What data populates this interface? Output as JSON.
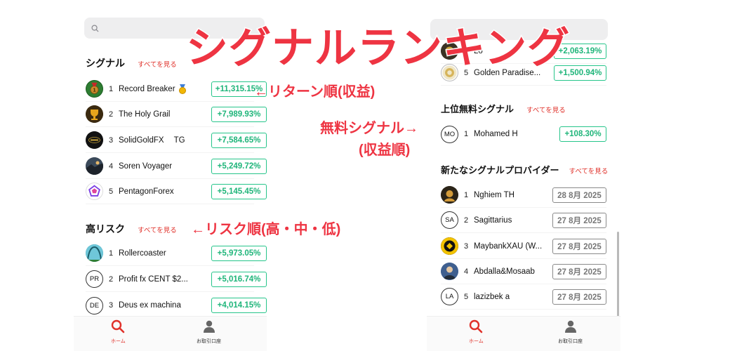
{
  "banner_title": "シグナルランキング",
  "annotations": {
    "return_order": "←リターン順(収益)",
    "risk_order": "←リスク順(高・中・低)",
    "free_signal_line1": "無料シグナル→",
    "free_signal_line2": "(収益順)"
  },
  "colors": {
    "accent": "#e0312a",
    "positive": "#1fb57a",
    "muted": "#777777",
    "annotation": "#ee3442"
  },
  "left": {
    "search": {
      "placeholder": "",
      "icon": "search-icon"
    },
    "signals": {
      "title": "シグナル",
      "see_all": "すべてを見る",
      "items": [
        {
          "rank": "1",
          "name": "Record Breaker",
          "value": "+11,315.15%",
          "medal": "🥇"
        },
        {
          "rank": "2",
          "name": "The Holy Grail",
          "value": "+7,989.93%"
        },
        {
          "rank": "3",
          "name": "SolidGoldFX",
          "suffix": "TG",
          "value": "+7,584.65%"
        },
        {
          "rank": "4",
          "name": "Soren Voyager",
          "value": "+5,249.72%"
        },
        {
          "rank": "5",
          "name": "PentagonForex",
          "value": "+5,145.45%"
        }
      ]
    },
    "high_risk": {
      "title": "高リスク",
      "see_all": "すべてを見る",
      "items": [
        {
          "rank": "1",
          "name": "Rollercoaster",
          "value": "+5,973.05%"
        },
        {
          "rank": "2",
          "initials": "PR",
          "name": "Profit fx CENT $2...",
          "value": "+5,016.74%"
        },
        {
          "rank": "3",
          "initials": "DE",
          "name": "Deus ex machina",
          "value": "+4,014.15%"
        }
      ]
    },
    "nav": {
      "home": "ホーム",
      "account": "お取引口座"
    }
  },
  "right": {
    "search": {
      "placeholder": ""
    },
    "top_items": [
      {
        "rank": "4",
        "name": "Lo",
        "value": "+2,063.19%"
      },
      {
        "rank": "5",
        "name": "Golden Paradise...",
        "value": "+1,500.94%"
      }
    ],
    "free_signals": {
      "title": "上位無料シグナル",
      "see_all": "すべてを見る",
      "items": [
        {
          "rank": "1",
          "initials": "MO",
          "name": "Mohamed H",
          "value": "+108.30%"
        }
      ]
    },
    "new_providers": {
      "title": "新たなシグナルプロバイダー",
      "see_all": "すべてを見る",
      "items": [
        {
          "rank": "1",
          "name": "Nghiem TH",
          "date": "28 8月 2025"
        },
        {
          "rank": "2",
          "initials": "SA",
          "name": "Sagittarius",
          "date": "27 8月 2025"
        },
        {
          "rank": "3",
          "name": "MaybankXAU (W...",
          "date": "27 8月 2025"
        },
        {
          "rank": "4",
          "name": "Abdalla&Mosaab",
          "date": "27 8月 2025"
        },
        {
          "rank": "5",
          "initials": "LA",
          "name": "lazizbek a",
          "date": "27 8月 2025"
        }
      ]
    },
    "nav": {
      "home": "ホーム",
      "account": "お取引口座"
    }
  }
}
